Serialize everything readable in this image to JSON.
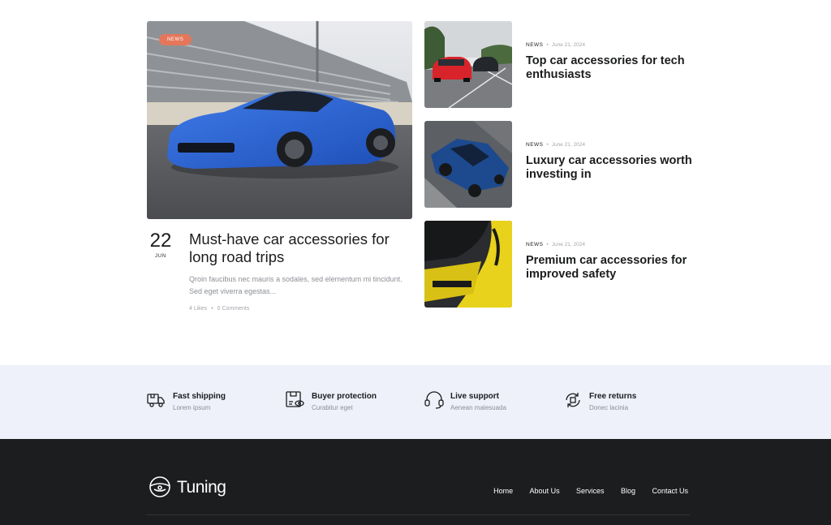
{
  "featured": {
    "badge": "NEWS",
    "day": "22",
    "month": "JUN",
    "title": "Must-have car accessories for long road trips",
    "excerpt": "Qroin faucibus nec mauris a sodales, sed elementum mi tincidunt. Sed eget viverra egestas...",
    "likes": "4 Likes",
    "comments": "0 Comments"
  },
  "posts": [
    {
      "category": "NEWS",
      "date": "June 21, 2024",
      "title": "Top car accessories for tech enthusiasts"
    },
    {
      "category": "NEWS",
      "date": "June 21, 2024",
      "title": "Luxury car accessories worth investing in"
    },
    {
      "category": "NEWS",
      "date": "June 21, 2024",
      "title": "Premium car accessories for improved safety"
    }
  ],
  "features": [
    {
      "icon": "truck-icon",
      "title": "Fast shipping",
      "subtitle": "Lorem ipsum"
    },
    {
      "icon": "box-eye-icon",
      "title": "Buyer protection",
      "subtitle": "Curabitur eget"
    },
    {
      "icon": "headset-icon",
      "title": "Live support",
      "subtitle": "Aenean malesuada"
    },
    {
      "icon": "returns-icon",
      "title": "Free returns",
      "subtitle": "Donec lacinia"
    }
  ],
  "footer": {
    "logo_text": "Tuning",
    "nav": [
      "Home",
      "About Us",
      "Services",
      "Blog",
      "Contact Us"
    ]
  },
  "colors": {
    "badge": "#e5765a",
    "features_bg": "#eef0fa",
    "footer_bg": "#1c1d1f",
    "text_dark": "#1b1c1e",
    "text_muted": "#8c8f95"
  }
}
